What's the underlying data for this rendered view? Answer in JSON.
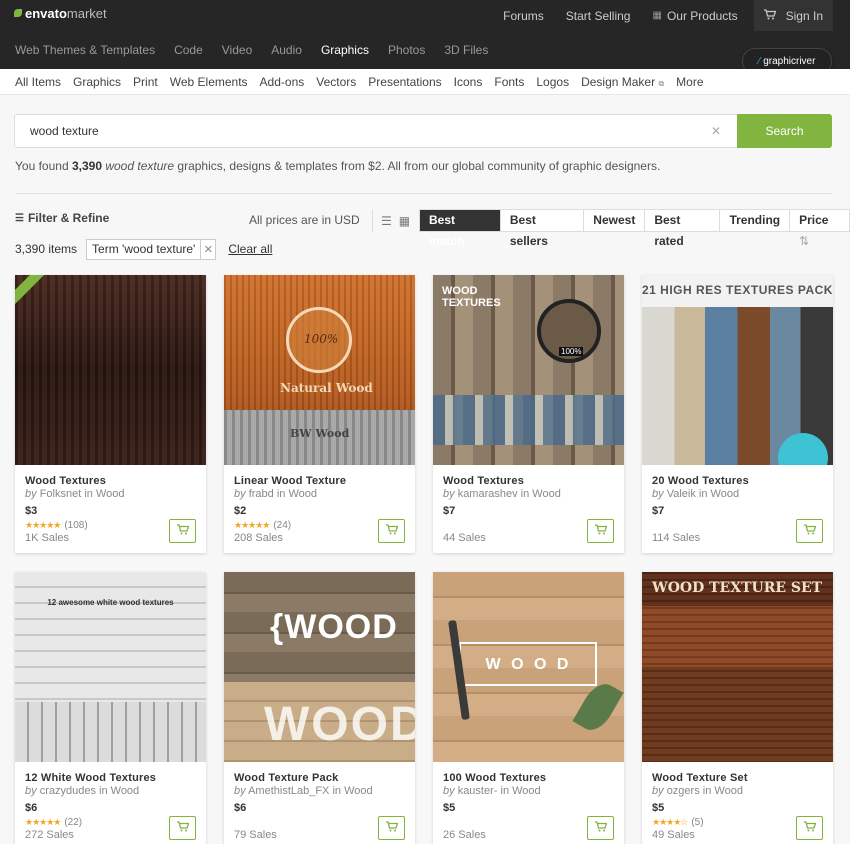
{
  "header": {
    "logo_a": "envato",
    "logo_b": "market",
    "links": [
      "Forums",
      "Start Selling",
      "Our Products",
      "Sign In"
    ]
  },
  "categories": [
    "Web Themes & Templates",
    "Code",
    "Video",
    "Audio",
    "Graphics",
    "Photos",
    "3D Files"
  ],
  "badge": "graphicriver",
  "subnav": [
    "All Items",
    "Graphics",
    "Print",
    "Web Elements",
    "Add-ons",
    "Vectors",
    "Presentations",
    "Icons",
    "Fonts",
    "Logos",
    "Design Maker",
    "More"
  ],
  "search": {
    "value": "wood texture",
    "button": "Search"
  },
  "found": {
    "prefix": "You found",
    "count": "3,390",
    "term": "wood texture",
    "suffix": "graphics, designs & templates from $2. All from our global community of graphic designers."
  },
  "filter": {
    "label": "Filter & Refine",
    "prices_note": "All prices are in USD"
  },
  "sorts": [
    "Best match",
    "Best sellers",
    "Newest",
    "Best rated",
    "Trending",
    "Price"
  ],
  "results": {
    "count": "3,390 items",
    "chip": "Term 'wood texture'",
    "clear": "Clear all"
  },
  "colors": {
    "accent": "#82b440",
    "dark": "#262626",
    "star": "#f5a623"
  },
  "items": [
    {
      "title": "Wood Textures",
      "by": "by",
      "author": "Folksnet",
      "in": "in Wood",
      "price": "$3",
      "rating": "(108)",
      "sales": "1K Sales",
      "thumb_text": ""
    },
    {
      "title": "Linear Wood Texture",
      "by": "by",
      "author": "frabd",
      "in": "in Wood",
      "price": "$2",
      "rating": "(24)",
      "sales": "208 Sales",
      "thumb_text": "Natural Wood",
      "thumb_text2": "BW Wood",
      "thumb_text3": "100%"
    },
    {
      "title": "Wood Textures",
      "by": "by",
      "author": "kamarashev",
      "in": "in Wood",
      "price": "$7",
      "rating": "",
      "sales": "44 Sales",
      "thumb_text": "WOOD TEXTURES",
      "thumb_text3": "100%"
    },
    {
      "title": "20 Wood Textures",
      "by": "by",
      "author": "Valeik",
      "in": "in Wood",
      "price": "$7",
      "rating": "",
      "sales": "114 Sales",
      "thumb_text": "21 HIGH RES TEXTURES PACK"
    },
    {
      "title": "12 White Wood Textures",
      "by": "by",
      "author": "crazydudes",
      "in": "in Wood",
      "price": "$6",
      "rating": "(22)",
      "sales": "272 Sales",
      "thumb_text": "12 awesome white wood textures"
    },
    {
      "title": "Wood Texture Pack",
      "by": "by",
      "author": "AmethistLab_FX",
      "in": "in Wood",
      "price": "$6",
      "rating": "",
      "sales": "79 Sales",
      "thumb_text": "{WOOD",
      "thumb_text2": "WOOD"
    },
    {
      "title": "100 Wood Textures",
      "by": "by",
      "author": "kauster-",
      "in": "in Wood",
      "price": "$5",
      "rating": "",
      "sales": "26 Sales",
      "thumb_text": "W O O D"
    },
    {
      "title": "Wood Texture Set",
      "by": "by",
      "author": "ozgers",
      "in": "in Wood",
      "price": "$5",
      "rating": "(5)",
      "sales": "49 Sales",
      "thumb_text": "WOOD TEXTURE SET"
    }
  ]
}
